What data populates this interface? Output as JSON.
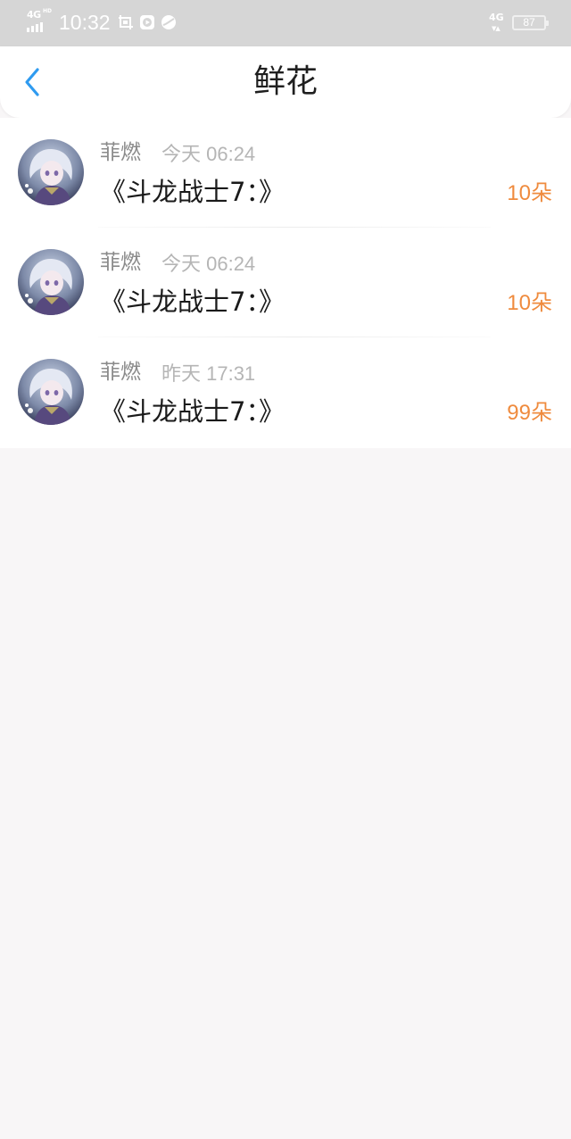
{
  "status_bar": {
    "network": "4G",
    "hd": "HD",
    "time": "10:32",
    "right_network": "4G",
    "battery": "87"
  },
  "header": {
    "title": "鲜花"
  },
  "items": [
    {
      "name": "菲燃",
      "time": "今天 06:24",
      "title": "《斗龙战士7：》",
      "amount": "10朵"
    },
    {
      "name": "菲燃",
      "time": "今天 06:24",
      "title": "《斗龙战士7：》",
      "amount": "10朵"
    },
    {
      "name": "菲燃",
      "time": "昨天 17:31",
      "title": "《斗龙战士7：》",
      "amount": "99朵"
    }
  ],
  "colors": {
    "accent": "#2f9bf0",
    "amount": "#ef8b3e",
    "status_bar": "#d6d6d6",
    "page_bg": "#f8f6f7"
  },
  "icons": {
    "back": "chevron-left-icon",
    "avatar": "anime-avatar-image"
  }
}
